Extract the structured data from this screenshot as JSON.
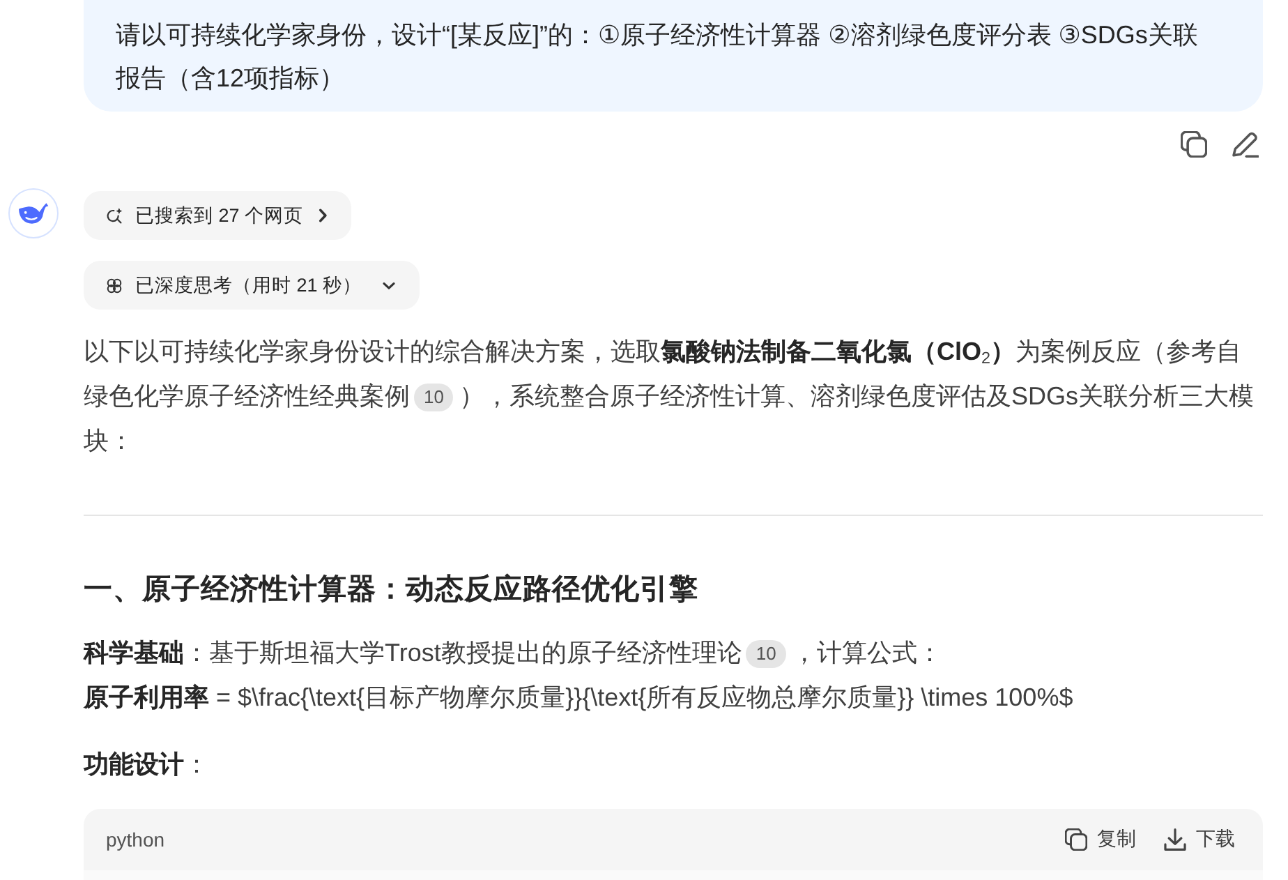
{
  "user_message": {
    "text": "请以可持续化学家身份，设计“[某反应]”的：①原子经济性计算器 ②溶剂绿色度评分表 ③SDGs关联报告（含12项指标）"
  },
  "assistant": {
    "search_pill": {
      "label": "已搜索到 27 个网页"
    },
    "thinking_pill": {
      "label": "已深度思考（用时 21 秒）"
    },
    "intro": [
      {
        "kind": "text",
        "text": "以下以可持续化学家身份设计的综合解决方案，选取**氯酸钠法制备二氧化氯（ClO**$_{2}$**）**为案例反应（参考自绿色化学原子经济性经典案例"
      },
      {
        "kind": "citation",
        "text": "10"
      },
      {
        "kind": "text",
        "text": "），系统整合原子经济性计算、溶剂绿色度评估及SDGs关联分析三大模块："
      }
    ],
    "section_heading": "一、原子经济性计算器：动态反应路径优化引擎",
    "basis": [
      {
        "kind": "text",
        "text": "**科学基础**：基于斯坦福大学Trost教授提出的原子经济性理论"
      },
      {
        "kind": "citation",
        "text": "10"
      },
      {
        "kind": "text",
        "text": "，计算公式："
      }
    ],
    "formula": "**原子利用率** = $\\frac{\\text{目标产物摩尔质量}}{\\text{所有反应物总摩尔质量}} \\times 100%$",
    "design_label": "**功能设计**：",
    "code_block": {
      "language": "python",
      "actions": [
        {
          "kind": "copy",
          "label": "复制"
        },
        {
          "kind": "download",
          "label": "下载"
        }
      ]
    }
  }
}
